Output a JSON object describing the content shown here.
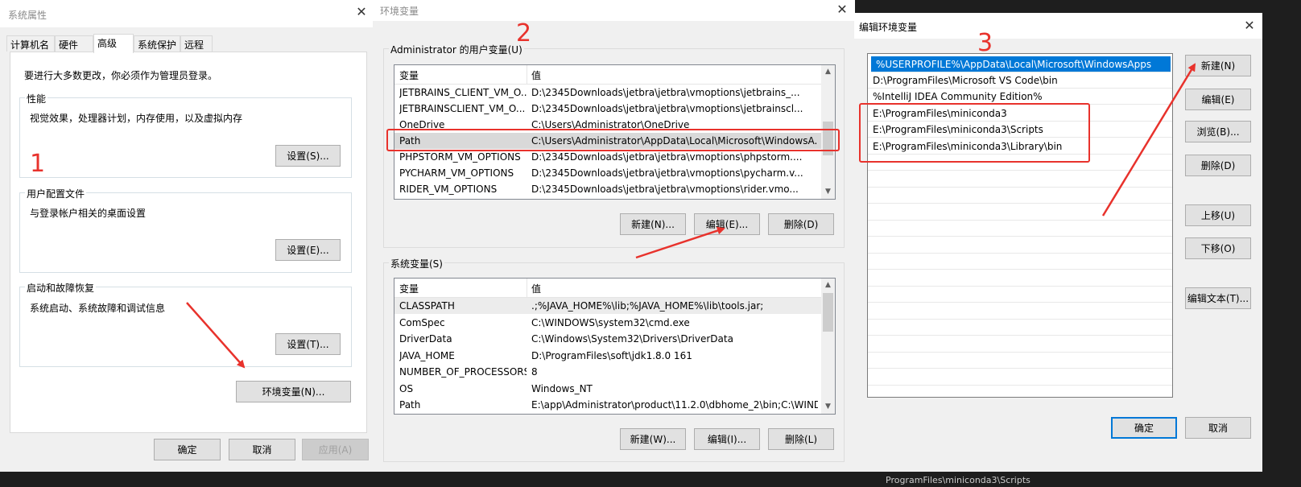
{
  "colors": {
    "accent": "#0078d7",
    "annotation": "#e8322c",
    "dialog_bg": "#f0f0f0"
  },
  "sysprops": {
    "title": "系统属性",
    "tabs": [
      "计算机名",
      "硬件",
      "高级",
      "系统保护",
      "远程"
    ],
    "active_tab": "高级",
    "admin_notice": "要进行大多数更改，你必须作为管理员登录。",
    "perf": {
      "label": "性能",
      "desc": "视觉效果，处理器计划，内存使用，以及虚拟内存",
      "btn": "设置(S)..."
    },
    "profile": {
      "label": "用户配置文件",
      "desc": "与登录帐户相关的桌面设置",
      "btn": "设置(E)..."
    },
    "startup": {
      "label": "启动和故障恢复",
      "desc": "系统启动、系统故障和调试信息",
      "btn": "设置(T)..."
    },
    "envvar_btn": "环境变量(N)...",
    "ok": "确定",
    "cancel": "取消",
    "apply": "应用(A)"
  },
  "envvars": {
    "title": "环境变量",
    "user_group_label": "Administrator 的用户变量(U)",
    "col_var": "变量",
    "col_val": "值",
    "user_rows": [
      {
        "name": "JETBRAINS_CLIENT_VM_O...",
        "value": "D:\\2345Downloads\\jetbra\\jetbra\\vmoptions\\jetbrains_..."
      },
      {
        "name": "JETBRAINSCLIENT_VM_O...",
        "value": "D:\\2345Downloads\\jetbra\\jetbra\\vmoptions\\jetbrainscl..."
      },
      {
        "name": "OneDrive",
        "value": "C:\\Users\\Administrator\\OneDrive"
      },
      {
        "name": "Path",
        "value": "C:\\Users\\Administrator\\AppData\\Local\\Microsoft\\WindowsA..."
      },
      {
        "name": "PHPSTORM_VM_OPTIONS",
        "value": "D:\\2345Downloads\\jetbra\\jetbra\\vmoptions\\phpstorm...."
      },
      {
        "name": "PYCHARM_VM_OPTIONS",
        "value": "D:\\2345Downloads\\jetbra\\jetbra\\vmoptions\\pycharm.v..."
      },
      {
        "name": "RIDER_VM_OPTIONS",
        "value": "D:\\2345Downloads\\jetbra\\jetbra\\vmoptions\\rider.vmo..."
      }
    ],
    "user_new": "新建(N)...",
    "user_edit": "编辑(E)...",
    "user_delete": "删除(D)",
    "sys_group_label": "系统变量(S)",
    "sys_rows": [
      {
        "name": "CLASSPATH",
        "value": ".;%JAVA_HOME%\\lib;%JAVA_HOME%\\lib\\tools.jar;"
      },
      {
        "name": "ComSpec",
        "value": "C:\\WINDOWS\\system32\\cmd.exe"
      },
      {
        "name": "DriverData",
        "value": "C:\\Windows\\System32\\Drivers\\DriverData"
      },
      {
        "name": "JAVA_HOME",
        "value": "D:\\ProgramFiles\\soft\\jdk1.8.0 161"
      },
      {
        "name": "NUMBER_OF_PROCESSORS",
        "value": "8"
      },
      {
        "name": "OS",
        "value": "Windows_NT"
      },
      {
        "name": "Path",
        "value": "E:\\app\\Administrator\\product\\11.2.0\\dbhome_2\\bin;C:\\WIND..."
      }
    ],
    "sys_new": "新建(W)...",
    "sys_edit": "编辑(I)...",
    "sys_delete": "删除(L)"
  },
  "editenv": {
    "title": "编辑环境变量",
    "entries": [
      "%USERPROFILE%\\AppData\\Local\\Microsoft\\WindowsApps",
      "D:\\ProgramFiles\\Microsoft VS Code\\bin",
      "%IntelliJ IDEA Community Edition%",
      "E:\\ProgramFiles\\miniconda3",
      "E:\\ProgramFiles\\miniconda3\\Scripts",
      "E:\\ProgramFiles\\miniconda3\\Library\\bin"
    ],
    "new": "新建(N)",
    "edit": "编辑(E)",
    "browse": "浏览(B)...",
    "delete": "删除(D)",
    "move_up": "上移(U)",
    "move_down": "下移(O)",
    "edit_text": "编辑文本(T)...",
    "ok": "确定",
    "cancel": "取消"
  },
  "annotations": {
    "step1": "1",
    "step2": "2",
    "step3": "3"
  },
  "background_text": "ProgramFiles\\miniconda3\\Scripts"
}
